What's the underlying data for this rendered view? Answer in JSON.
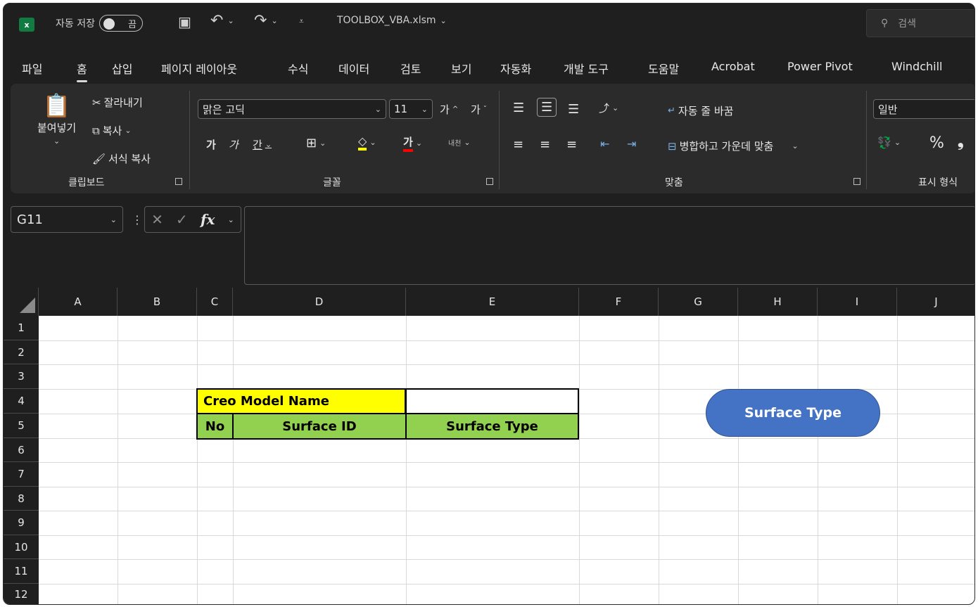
{
  "titlebar": {
    "autosave_label": "자동 저장",
    "autosave_state": "끔",
    "filename": "TOOLBOX_VBA.xlsm",
    "search_placeholder": "검색"
  },
  "menu": {
    "tabs": [
      "파일",
      "홈",
      "삽입",
      "페이지 레이아웃",
      "수식",
      "데이터",
      "검토",
      "보기",
      "자동화",
      "개발 도구",
      "도움말",
      "Acrobat",
      "Power Pivot",
      "Windchill"
    ],
    "active": "홈"
  },
  "ribbon": {
    "clipboard": {
      "paste": "붙여넣기",
      "cut": "잘라내기",
      "copy": "복사",
      "format_painter": "서식 복사",
      "group": "클립보드"
    },
    "font": {
      "name": "맑은 고딕",
      "size": "11",
      "bold": "가",
      "italic": "가",
      "underline": "간",
      "grow": "가",
      "shrink": "가",
      "font_color": "가",
      "phonetic": "내천",
      "group": "글꼴"
    },
    "alignment": {
      "wrap": "자동 줄 바꿈",
      "merge": "병합하고 가운데 맞춤",
      "group": "맞춤"
    },
    "number": {
      "format": "일반",
      "percent": "%",
      "comma": "❟",
      "group": "표시 형식"
    }
  },
  "formula_bar": {
    "name_box": "G11",
    "fx": "fx",
    "content": ""
  },
  "sheet": {
    "columns": [
      "A",
      "B",
      "C",
      "D",
      "E",
      "F",
      "G",
      "H",
      "I",
      "J"
    ],
    "rows": [
      "1",
      "2",
      "3",
      "4",
      "5",
      "6",
      "7",
      "8",
      "9",
      "10",
      "11",
      "12"
    ],
    "cells": {
      "C4": "Creo Model Name",
      "C5": "No",
      "D5": "Surface ID",
      "E5": "Surface Type"
    },
    "button_label": "Surface Type",
    "colors": {
      "header_yellow": "#ffff00",
      "header_green": "#92d050",
      "button_blue": "#4472c4"
    }
  }
}
